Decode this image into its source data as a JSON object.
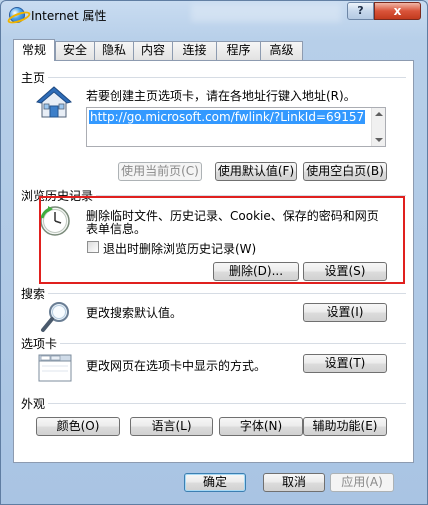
{
  "window": {
    "title": "Internet 属性",
    "help_label": "?",
    "close_label": "x"
  },
  "tabs": [
    {
      "label": "常规",
      "active": true
    },
    {
      "label": "安全"
    },
    {
      "label": "隐私"
    },
    {
      "label": "内容"
    },
    {
      "label": "连接"
    },
    {
      "label": "程序"
    },
    {
      "label": "高级"
    }
  ],
  "home": {
    "group_label": "主页",
    "description": "若要创建主页选项卡，请在各地址行键入地址(R)。",
    "url": "http://go.microsoft.com/fwlink/?LinkId=69157",
    "use_current": "使用当前页(C)",
    "use_default": "使用默认值(F)",
    "use_blank": "使用空白页(B)"
  },
  "history": {
    "group_label": "浏览历史记录",
    "description_line1": "删除临时文件、历史记录、Cookie、保存的密码和网页",
    "description_line2": "表单信息。",
    "checkbox_label": "退出时删除浏览历史记录(W)",
    "delete_button": "删除(D)...",
    "settings_button": "设置(S)"
  },
  "search": {
    "group_label": "搜索",
    "description": "更改搜索默认值。",
    "settings_button": "设置(I)"
  },
  "tabs_section": {
    "group_label": "选项卡",
    "description": "更改网页在选项卡中显示的方式。",
    "settings_button": "设置(T)"
  },
  "appearance": {
    "group_label": "外观",
    "colors": "颜色(O)",
    "languages": "语言(L)",
    "fonts": "字体(N)",
    "accessibility": "辅助功能(E)"
  },
  "footer": {
    "ok": "确定",
    "cancel": "取消",
    "apply": "应用(A)"
  },
  "colors": {
    "highlight": "#e0201e",
    "selection": "#3399ff"
  }
}
